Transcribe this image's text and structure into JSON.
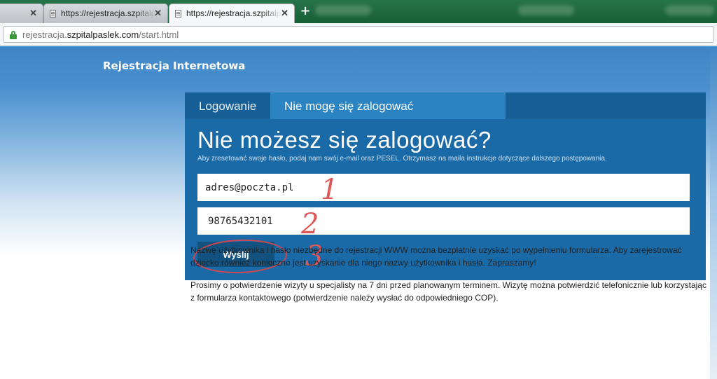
{
  "browser": {
    "tabs": [
      {
        "title": "",
        "close": "✕",
        "active": false
      },
      {
        "title": "https://rejestracja.szpitalpaslek.com",
        "close": "✕",
        "active": false
      },
      {
        "title": "https://rejestracja.szpitalpaslek.com/start.html",
        "close": "✕",
        "active": true
      }
    ],
    "new_tab": "+",
    "url_prefix": "rejestracja.",
    "url_domain": "szpitalpaslek.com",
    "url_path": "/start.html"
  },
  "site": {
    "title": "Rejestracja Internetowa"
  },
  "card": {
    "tabs": [
      "Logowanie",
      "Nie mogę się zalogować"
    ],
    "heading": "Nie możesz się zalogować?",
    "subtext": "Aby zresetować swoje hasło, podaj nam swój e-mail oraz PESEL. Otrzymasz na maila instrukcje dotyczące dalszego postępowania.",
    "email_value": "adres@poczta.pl",
    "pesel_value": "98765432101",
    "send_label": "Wyślij"
  },
  "annotations": [
    "1",
    "2",
    "3"
  ],
  "info": {
    "paragraph_1": "Nazwę użytkownika i hasło niezbędne do rejestracji WWW można bezpłatnie uzyskać po wypełnieniu formularza. Aby zarejestrować dziecko również konieczne jest uzyskanie dla niego nazwy użytkownika i hasła. Zapraszamy!",
    "paragraph_2": "Prosimy o potwierdzenie wizyty u specjalisty na 7 dni przed planowanym terminem. Wizytę można potwierdzić telefonicznie lub korzystając z formularza kontaktowego (potwierdzenie należy wysłać do odpowiedniego COP)."
  },
  "colors": {
    "header_blue": "#4a90cf",
    "card_blue": "#1a6aa8",
    "button_blue": "#13527f",
    "annotation_red": "#e05656"
  }
}
